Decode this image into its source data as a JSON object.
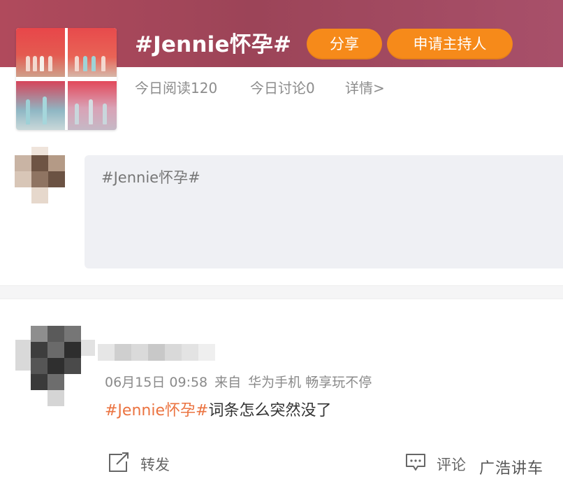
{
  "topic": {
    "title": "#Jennie怀孕#",
    "share_label": "分享",
    "host_label": "申请主持人",
    "read_stat": "今日阅读120",
    "discuss_stat": "今日讨论0",
    "detail_link": "详情>"
  },
  "compose": {
    "placeholder_text": "#Jennie怀孕#"
  },
  "post": {
    "date": "06月15日 09:58",
    "source_prefix": "来自",
    "device": "华为手机 畅享玩不停",
    "hashtag": "#Jennie怀孕#",
    "content": "词条怎么突然没了"
  },
  "actions": {
    "repost_label": "转发",
    "comment_label": "评论"
  },
  "watermark": {
    "text": "广浩讲车"
  },
  "colors": {
    "header": "#a34a5e",
    "accent_orange": "#f68a1a",
    "hashtag": "#eb7340"
  }
}
